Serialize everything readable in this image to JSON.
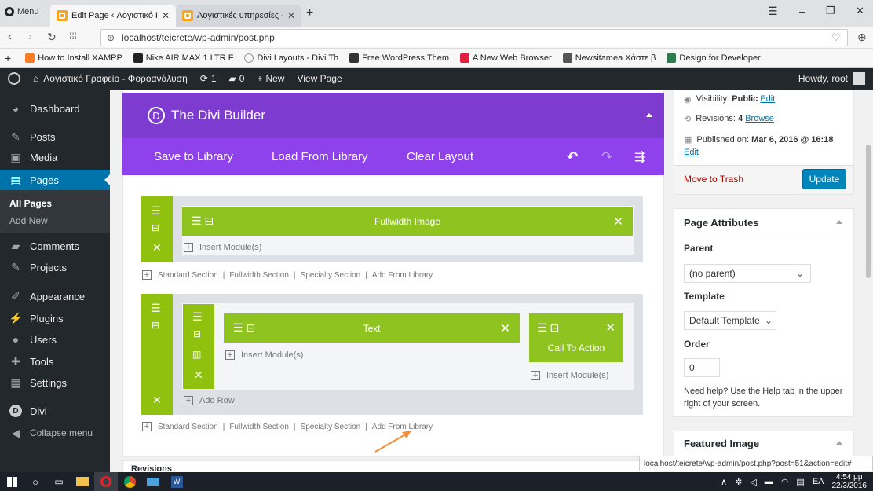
{
  "browser": {
    "menu_label": "Menu",
    "tabs": [
      {
        "title": "Edit Page ‹ Λογιστικό Γρα",
        "active": true
      },
      {
        "title": "Λογιστικές υπηρεσίες – Λ",
        "active": false
      }
    ],
    "url": "localhost/teicrete/wp-admin/post.php",
    "bookmarks": [
      "How to Install XAMPP",
      "Nike AIR MAX 1 LTR F",
      "Divi Layouts - Divi Th",
      "Free WordPress Them",
      "A New Web Browser",
      "Newsitamea Χάστε β",
      "Design for Developer"
    ]
  },
  "adminbar": {
    "site_name": "Λογιστικό Γραφείο - Φοροανάλυση",
    "updates_count": "1",
    "comments_count": "0",
    "new_label": "New",
    "view_page_label": "View Page",
    "howdy": "Howdy, root"
  },
  "sidebar": {
    "items": [
      {
        "label": "Dashboard",
        "icon": "dashboard-icon"
      },
      {
        "label": "Posts",
        "icon": "pin-icon"
      },
      {
        "label": "Media",
        "icon": "media-icon"
      },
      {
        "label": "Pages",
        "icon": "pages-icon"
      },
      {
        "label": "Comments",
        "icon": "comments-icon"
      },
      {
        "label": "Projects",
        "icon": "pin-icon"
      },
      {
        "label": "Appearance",
        "icon": "brush-icon"
      },
      {
        "label": "Plugins",
        "icon": "plugin-icon"
      },
      {
        "label": "Users",
        "icon": "users-icon"
      },
      {
        "label": "Tools",
        "icon": "wrench-icon"
      },
      {
        "label": "Settings",
        "icon": "settings-icon"
      },
      {
        "label": "Divi",
        "icon": "divi-icon"
      },
      {
        "label": "Collapse menu",
        "icon": "collapse-icon"
      }
    ],
    "sub_items": [
      "All Pages",
      "Add New"
    ]
  },
  "divi": {
    "title": "The Divi Builder",
    "save_label": "Save to Library",
    "load_label": "Load From Library",
    "clear_label": "Clear Layout",
    "section1": {
      "module": "Fullwidth Image",
      "insert": "Insert Module(s)"
    },
    "section2": {
      "text_module": "Text",
      "cta_module": "Call To Action",
      "insert_left": "Insert Module(s)",
      "insert_right": "Insert Module(s)",
      "add_row": "Add Row"
    },
    "section_links": [
      "Standard Section",
      "Fullwidth Section",
      "Specialty Section",
      "Add From Library"
    ],
    "revisions_label": "Revisions"
  },
  "publish": {
    "visibility_label": "Visibility:",
    "visibility_value": "Public",
    "visibility_edit": "Edit",
    "revisions_label": "Revisions:",
    "revisions_count": "4",
    "revisions_browse": "Browse",
    "published_label": "Published on:",
    "published_value": "Mar 6, 2016 @ 16:18",
    "published_edit": "Edit",
    "trash_label": "Move to Trash",
    "update_label": "Update"
  },
  "page_attributes": {
    "title": "Page Attributes",
    "parent_label": "Parent",
    "parent_value": "(no parent)",
    "template_label": "Template",
    "template_value": "Default Template",
    "order_label": "Order",
    "order_value": "0",
    "help_text": "Need help? Use the Help tab in the upper right of your screen."
  },
  "featured_image": {
    "title": "Featured Image"
  },
  "status_url": "localhost/teicrete/wp-admin/post.php?post=51&action=edit#",
  "taskbar": {
    "language": "ΕΛ",
    "time": "4:54 μμ",
    "date": "22/3/2016"
  },
  "colors": {
    "divi_purple_dark": "#7e3bd0",
    "divi_purple": "#8f42ec",
    "module_green": "#8fc31f",
    "wp_blue": "#0073aa",
    "trash_red": "#a00"
  }
}
